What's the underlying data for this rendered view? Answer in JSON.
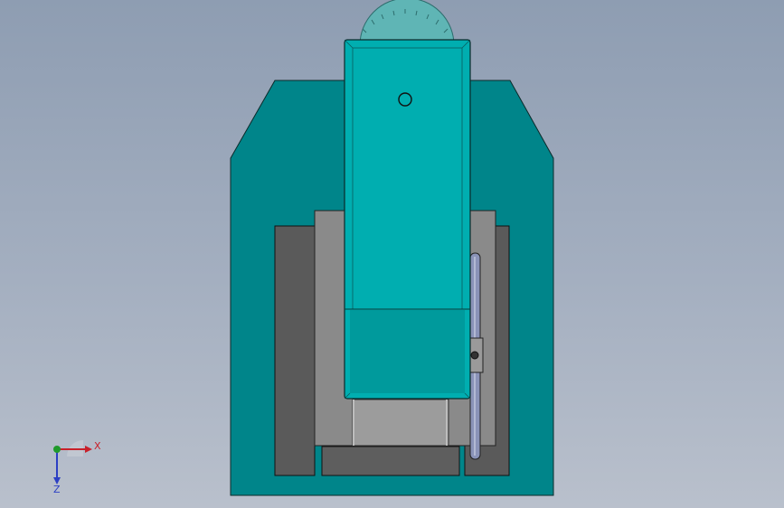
{
  "viewport": {
    "background_top": "#8e9db2",
    "background_bottom": "#b9c0cc"
  },
  "triad": {
    "x_label": "X",
    "z_label": "Z",
    "x_color": "#c8202a",
    "z_color": "#2c3fc4",
    "y_color": "#1f9a2b"
  },
  "model": {
    "body_color": "#00858a",
    "slider_color": "#00aeb0",
    "plate_color": "#5a5a5a",
    "block_color": "#8a8a8a",
    "gear_color": "#5fb5b5",
    "rod_color": "#8a93b8"
  }
}
